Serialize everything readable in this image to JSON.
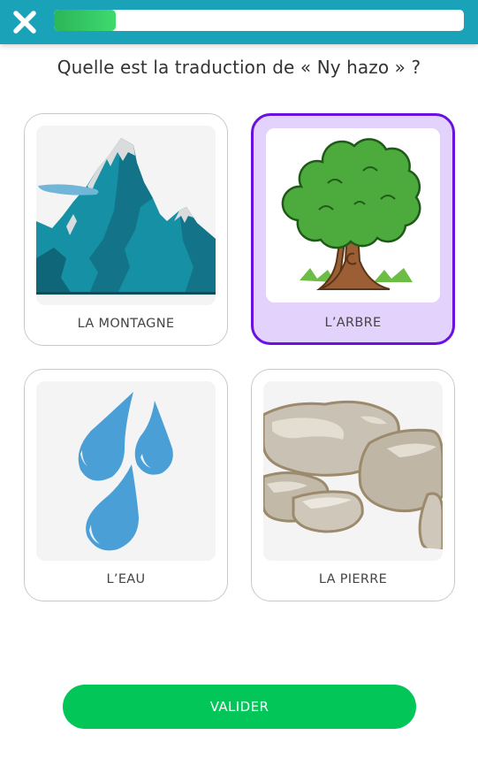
{
  "header": {
    "close_icon": "close-icon",
    "progress": 0.15,
    "colors": {
      "bar": "#1aa3b8",
      "progress": "#2bb559"
    }
  },
  "question": "Quelle est la traduction de « Ny hazo » ?",
  "options": [
    {
      "label": "LA MONTAGNE",
      "icon": "mountain-image",
      "selected": false
    },
    {
      "label": "L’ARBRE",
      "icon": "tree-image",
      "selected": true
    },
    {
      "label": "L’EAU",
      "icon": "water-drops-image",
      "selected": false
    },
    {
      "label": "LA PIERRE",
      "icon": "stones-image",
      "selected": false
    }
  ],
  "actions": {
    "validate_label": "VALIDER",
    "color": "#02c658"
  },
  "selection_color": "#6a11e0"
}
